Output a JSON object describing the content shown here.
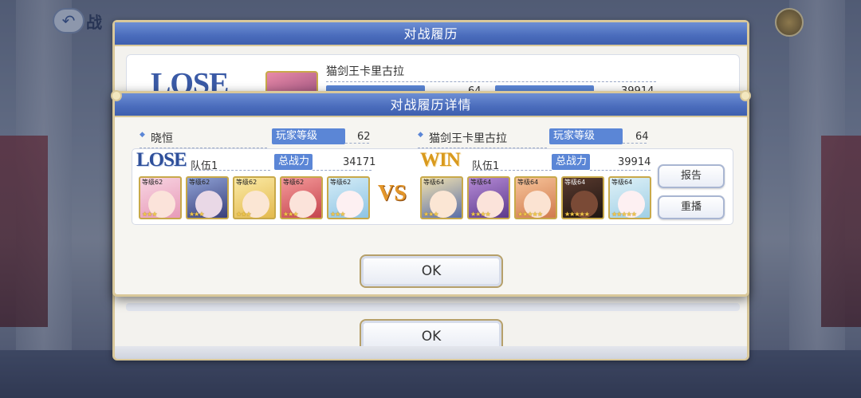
{
  "background": {
    "title_partial": "战",
    "back_icon": "back-arrow-icon"
  },
  "history_dialog": {
    "title": "对战履历",
    "row": {
      "result": "LOSE",
      "opponent_name": "猫剑王卡里古拉",
      "level_value": "64",
      "power_value": "39914"
    },
    "ok_label": "OK"
  },
  "detail_dialog": {
    "title": "对战履历详情",
    "left": {
      "player_name": "晓恒",
      "level_label": "玩家等级",
      "level": "62",
      "result": "LOSE",
      "team": "队伍1",
      "power_label": "总战力",
      "power": "34171",
      "characters": [
        {
          "level": "等级62",
          "stars": "★★★"
        },
        {
          "level": "等级62",
          "stars": "★★★"
        },
        {
          "level": "等级62",
          "stars": "★★★"
        },
        {
          "level": "等级62",
          "stars": "★★★"
        },
        {
          "level": "等级62",
          "stars": "★★★"
        }
      ]
    },
    "vs": "VS",
    "right": {
      "player_name": "猫剑王卡里古拉",
      "level_label": "玩家等级",
      "level": "64",
      "result": "WIN",
      "team": "队伍1",
      "power_label": "总战力",
      "power": "39914",
      "characters": [
        {
          "level": "等级64",
          "stars": "★★★"
        },
        {
          "level": "等级64",
          "stars": "★★★★"
        },
        {
          "level": "等级64",
          "stars": "★★★★★"
        },
        {
          "level": "等级64",
          "stars": "★★★★★"
        },
        {
          "level": "等级64",
          "stars": "★★★★★"
        }
      ]
    },
    "report_label": "报告",
    "replay_label": "重播",
    "ok_label": "OK"
  },
  "colors": {
    "header_blue": "#4a6cbc",
    "label_blue": "#5b86d6",
    "gold_border": "#d9c89a",
    "lose_color": "#2e4f9a",
    "win_color": "#d99a1e"
  }
}
